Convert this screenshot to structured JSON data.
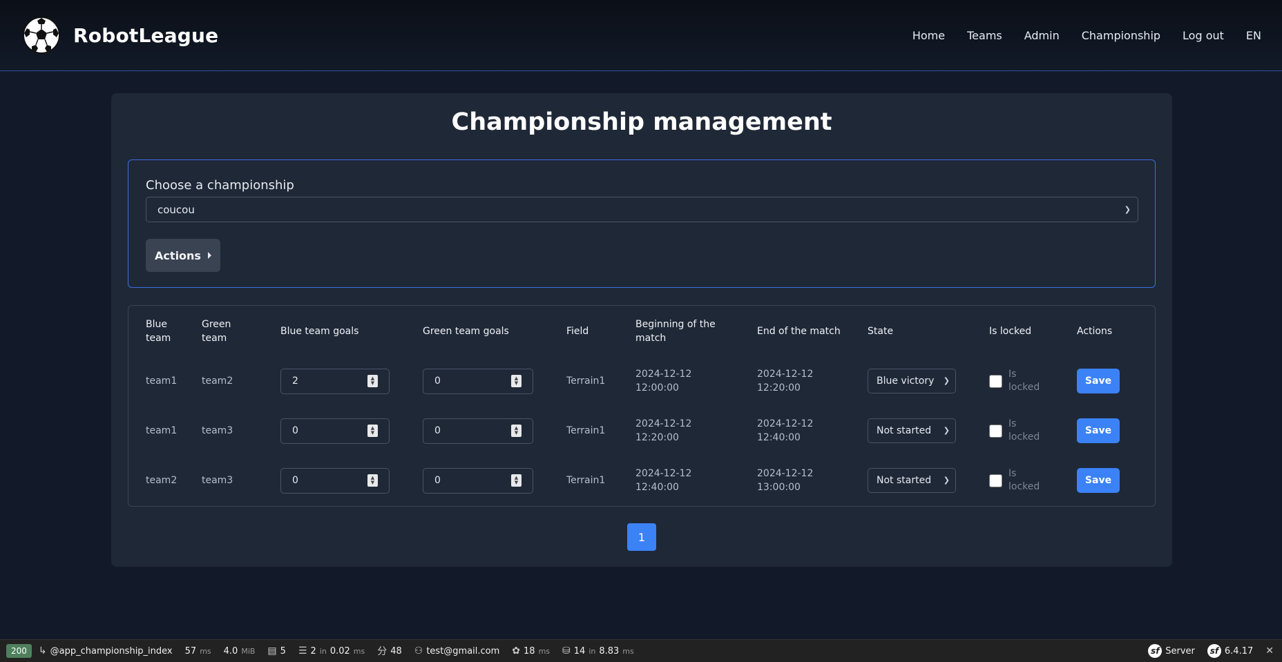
{
  "brand": {
    "name": "RobotLeague"
  },
  "nav": [
    "Home",
    "Teams",
    "Admin",
    "Championship",
    "Log out",
    "EN"
  ],
  "page": {
    "title": "Championship management",
    "choose_label": "Choose a championship",
    "selected_championship": "coucou",
    "actions_label": "Actions"
  },
  "table": {
    "headers": {
      "blue_team": "Blue team",
      "green_team": "Green team",
      "blue_goals": "Blue team goals",
      "green_goals": "Green team goals",
      "field": "Field",
      "beginning": "Beginning of the match",
      "end": "End of the match",
      "state": "State",
      "is_locked": "Is locked",
      "actions": "Actions"
    },
    "rows": [
      {
        "blue": "team1",
        "green": "team2",
        "blue_goals": "2",
        "green_goals": "0",
        "field": "Terrain1",
        "begin_date": "2024-12-12",
        "begin_time": "12:00:00",
        "end_date": "2024-12-12",
        "end_time": "12:20:00",
        "state": "Blue victory",
        "lock_label": "Is locked",
        "save": "Save"
      },
      {
        "blue": "team1",
        "green": "team3",
        "blue_goals": "0",
        "green_goals": "0",
        "field": "Terrain1",
        "begin_date": "2024-12-12",
        "begin_time": "12:20:00",
        "end_date": "2024-12-12",
        "end_time": "12:40:00",
        "state": "Not started",
        "lock_label": "Is locked",
        "save": "Save"
      },
      {
        "blue": "team2",
        "green": "team3",
        "blue_goals": "0",
        "green_goals": "0",
        "field": "Terrain1",
        "begin_date": "2024-12-12",
        "begin_time": "12:40:00",
        "end_date": "2024-12-12",
        "end_time": "13:00:00",
        "state": "Not started",
        "lock_label": "Is locked",
        "save": "Save"
      }
    ]
  },
  "pagination": {
    "current": "1"
  },
  "debug_toolbar": {
    "status": "200",
    "route": "@app_championship_index",
    "time": "57",
    "time_unit": "ms",
    "memory": "4.0",
    "memory_unit": "MiB",
    "forms": "5",
    "cache_calls": "2",
    "cache_in": "in",
    "cache_time": "0.02",
    "cache_unit": "ms",
    "translations": "48",
    "user": "test@gmail.com",
    "twig_time": "18",
    "twig_unit": "ms",
    "db_queries": "14",
    "db_in": "in",
    "db_time": "8.83",
    "db_unit": "ms",
    "server": "Server",
    "version": "6.4.17"
  },
  "colors": {
    "accent": "#3b82f6",
    "bg": "#121a29",
    "card": "#1f2837",
    "border_focus": "#3b6fe0"
  }
}
